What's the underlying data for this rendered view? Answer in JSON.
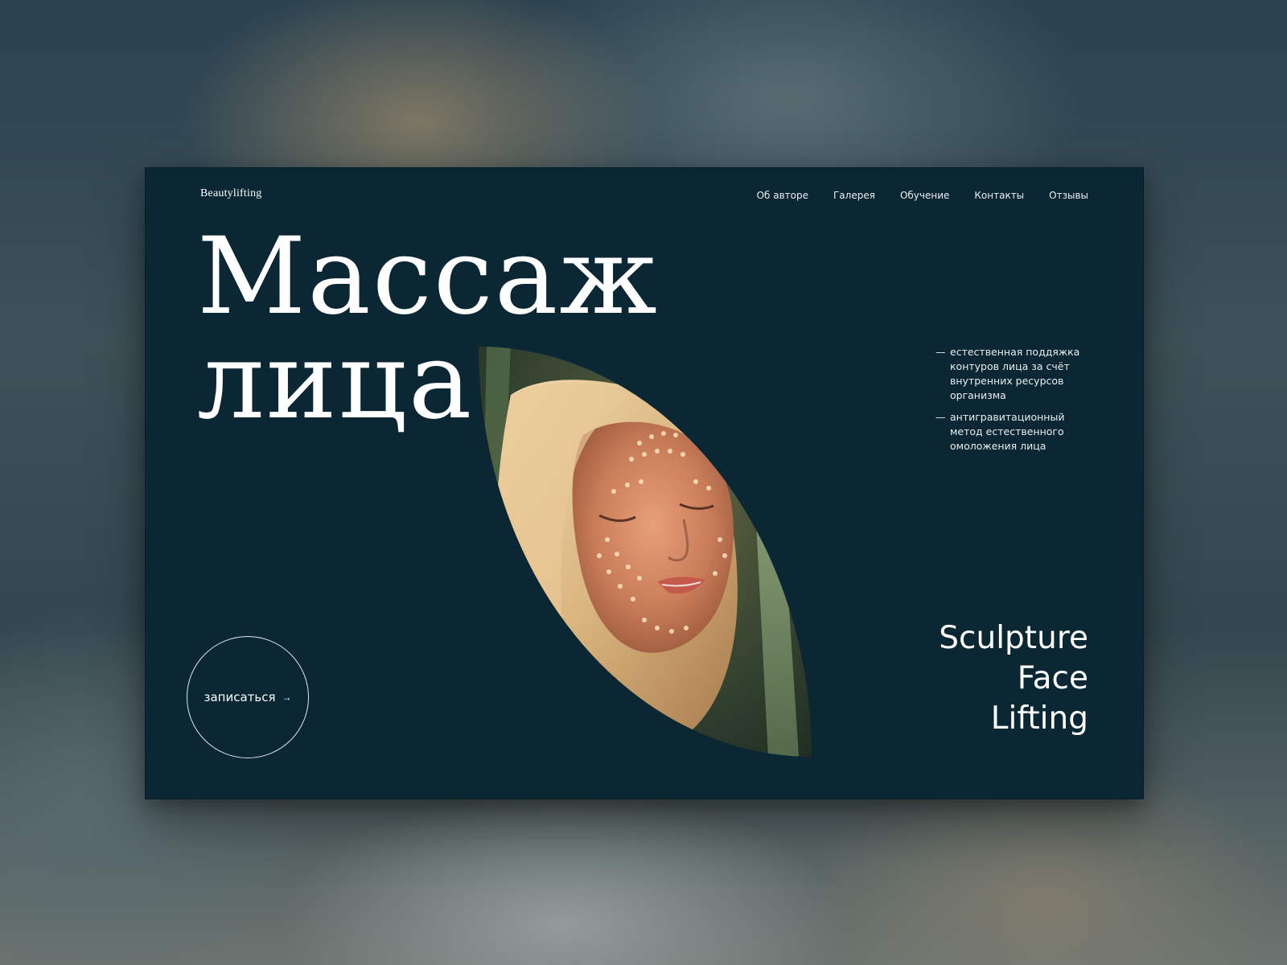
{
  "brand": {
    "logo": "Beautylifting"
  },
  "nav": {
    "items": [
      {
        "label": "Об авторе"
      },
      {
        "label": "Галерея"
      },
      {
        "label": "Обучение"
      },
      {
        "label": "Контакты"
      },
      {
        "label": "Отзывы"
      }
    ]
  },
  "hero": {
    "title_line1": "Массаж",
    "title_line2": "лица",
    "bullets": [
      {
        "dash": "—",
        "text": "естественная поддяжка контуров лица за счёт внутренних ресурсов организма"
      },
      {
        "dash": "—",
        "text": "антигравитационный метод естественного омоложения лица"
      }
    ],
    "tagline": {
      "line1": "Sculpture",
      "line2": "Face",
      "line3": "Lifting"
    },
    "cta": {
      "label": "записаться",
      "icon": "arrow-right-icon"
    }
  },
  "colors": {
    "background": "#0b2733",
    "text": "#ffffff"
  }
}
